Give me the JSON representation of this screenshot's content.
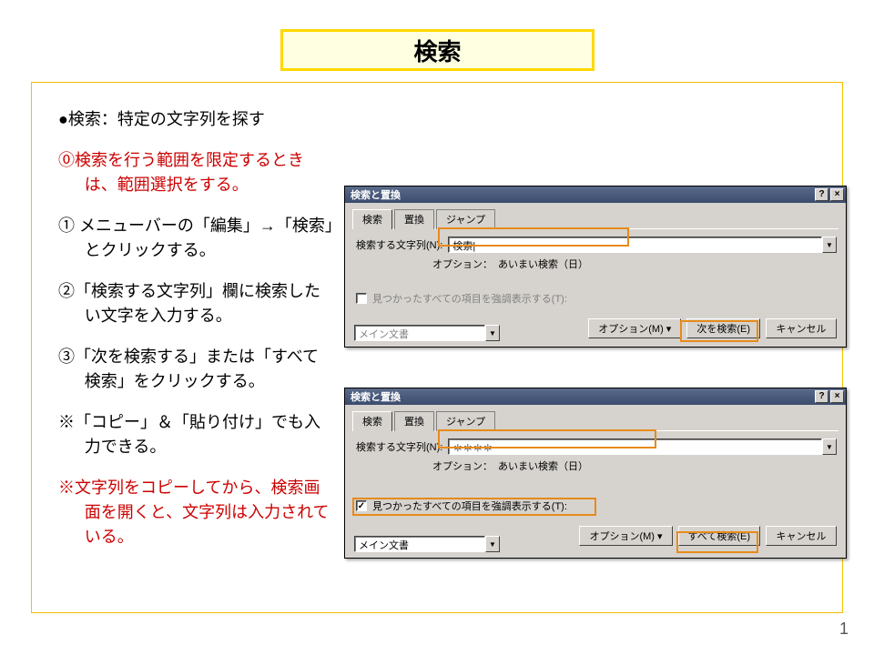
{
  "banner": {
    "title": "検索"
  },
  "page_number": "1",
  "instructions": {
    "heading": "●検索：特定の文字列を探す",
    "step0": "⓪検索を行う範囲を限定するときは、範囲選択をする。",
    "step1": "① メニューバーの「編集」→「検索」とクリックする。",
    "step2": "②「検索する文字列」欄に検索したい文字を入力する。",
    "step3": "③「次を検索する」または「すべて検索」をクリックする。",
    "note1": "※「コピー」＆「貼り付け」でも入力できる。",
    "note2": "※文字列をコピーしてから、検索画面を開くと、文字列は入力されている。"
  },
  "dialog_common": {
    "title": "検索と置換",
    "tabs": {
      "search": "検索",
      "replace": "置換",
      "jump": "ジャンプ"
    },
    "search_label": "検索する文字列(N):",
    "option_line_label": "オプション：",
    "option_line_value": "あいまい検索（日）",
    "highlight_label": "見つかったすべての項目を強調表示する(T):",
    "scope_value": "メイン文書",
    "btn_options": "オプション(M)",
    "btn_find_next": "次を検索(E)",
    "btn_find_all": "すべて検索(E)",
    "btn_cancel": "キャンセル",
    "help": "?",
    "close": "×",
    "chevron": "▼"
  },
  "dialog1": {
    "search_value": "検索",
    "highlight_checked": false
  },
  "dialog2": {
    "search_value": "＊＊＊＊",
    "highlight_checked": true
  }
}
